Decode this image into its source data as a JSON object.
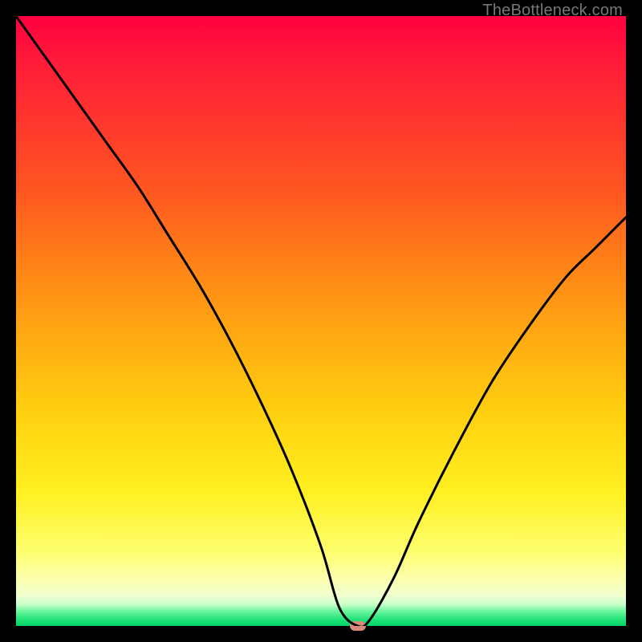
{
  "watermark": "TheBottleneck.com",
  "colors": {
    "frame": "#000000",
    "curve_stroke": "#000000",
    "marker": "#d98a7a",
    "gradient_top": "#ff0040",
    "gradient_bottom": "#00d468"
  },
  "chart_data": {
    "type": "line",
    "title": "",
    "xlabel": "",
    "ylabel": "",
    "xlim": [
      0,
      100
    ],
    "ylim": [
      0,
      100
    ],
    "grid": false,
    "legend": false,
    "annotations": [
      "TheBottleneck.com"
    ],
    "marker": {
      "x": 56,
      "y": 0,
      "color": "#d98a7a"
    },
    "series": [
      {
        "name": "bottleneck-curve",
        "x": [
          0,
          5,
          10,
          15,
          20,
          25,
          30,
          35,
          40,
          45,
          50,
          53,
          56,
          58,
          62,
          66,
          72,
          78,
          84,
          90,
          95,
          100
        ],
        "values": [
          100,
          93,
          86,
          79,
          72,
          64,
          56,
          47,
          37,
          26,
          13,
          3,
          0,
          1,
          8,
          17,
          29,
          40,
          49,
          57,
          62,
          67
        ]
      }
    ],
    "background_gradient_stops": [
      {
        "pos": 0.0,
        "color": "#ff0040"
      },
      {
        "pos": 0.15,
        "color": "#ff3030"
      },
      {
        "pos": 0.4,
        "color": "#ff8018"
      },
      {
        "pos": 0.65,
        "color": "#ffd010"
      },
      {
        "pos": 0.88,
        "color": "#fdff70"
      },
      {
        "pos": 0.965,
        "color": "#c8ffca"
      },
      {
        "pos": 1.0,
        "color": "#00d468"
      }
    ]
  }
}
